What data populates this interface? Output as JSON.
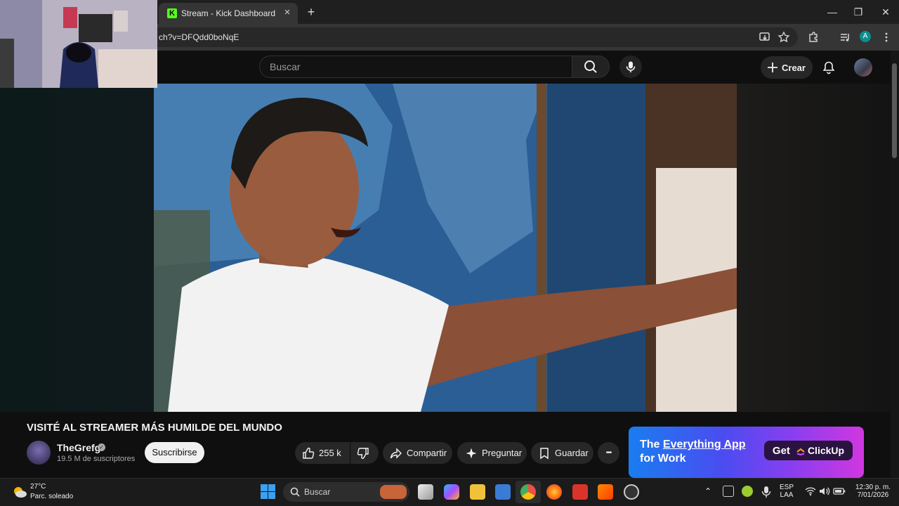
{
  "browser": {
    "tab_title": "Stream - Kick Dashboard",
    "tab_favicon_letter": "K",
    "tab_close": "×",
    "new_tab": "+",
    "url": "ch?v=DFQdd0boNqE",
    "profile_initial": "A",
    "window_controls": [
      "—",
      "❐",
      "✕"
    ]
  },
  "youtube": {
    "search_placeholder": "Buscar",
    "create_label": "Crear",
    "video_title": "VISITÉ AL STREAMER MÁS HUMILDE DEL MUNDO",
    "channel_name": "TheGrefg",
    "subscribers": "19.5 M de suscriptores",
    "subscribe_label": "Suscribirse",
    "likes": "255 k",
    "share_label": "Compartir",
    "ask_label": "Preguntar",
    "save_label": "Guardar",
    "more_label": "•••"
  },
  "ad": {
    "line1_prefix": "The",
    "line1_highlight": "Everything App",
    "line2": "for Work",
    "cta_get": "Get",
    "cta_brand": "ClickUp"
  },
  "taskbar": {
    "temperature": "27°C",
    "weather": "Parc. soleado",
    "search_label": "Buscar",
    "lang_1": "ESP",
    "lang_2": "LAA",
    "time": "12:30 p. m.",
    "date": "7/01/2026"
  },
  "colors": {
    "kick_green": "#53fc18",
    "yt_bg": "#0f0f0f",
    "ad_gradient_start": "#1a7df0",
    "ad_gradient_end": "#d237e0"
  }
}
